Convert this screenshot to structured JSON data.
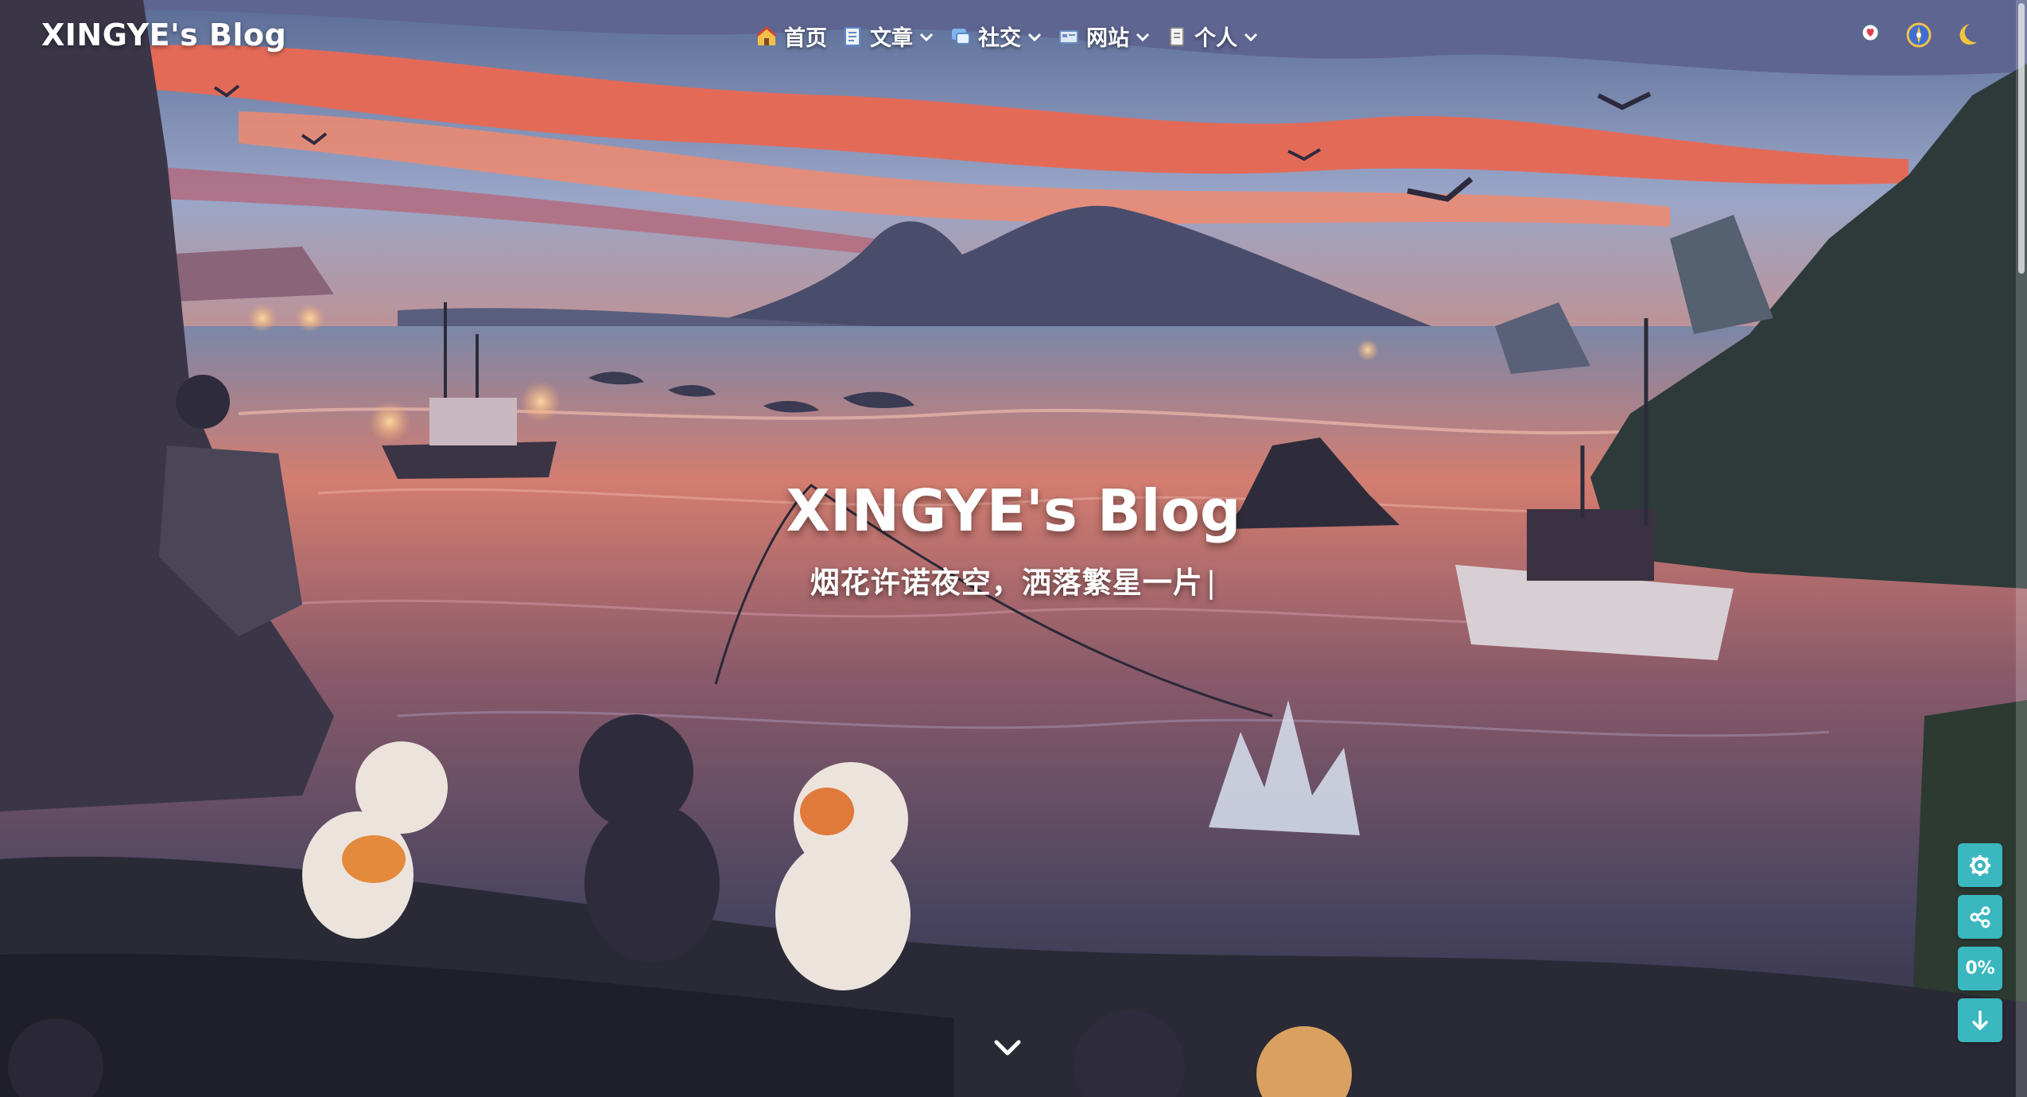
{
  "site": {
    "name": "XINGYE's Blog"
  },
  "nav": {
    "items": [
      {
        "label": "首页",
        "icon": "home-icon",
        "has_dropdown": false
      },
      {
        "label": "文章",
        "icon": "article-icon",
        "has_dropdown": true
      },
      {
        "label": "社交",
        "icon": "chat-icon",
        "has_dropdown": true
      },
      {
        "label": "网站",
        "icon": "website-icon",
        "has_dropdown": true
      },
      {
        "label": "个人",
        "icon": "profile-icon",
        "has_dropdown": true
      }
    ],
    "tools": [
      {
        "name": "search-heart-icon"
      },
      {
        "name": "compass-icon"
      },
      {
        "name": "moon-icon"
      }
    ]
  },
  "hero": {
    "title": "XINGYE's Blog",
    "subtitle": "烟花许诺夜空，洒落繁星一片",
    "cursor": "|"
  },
  "side_buttons": {
    "settings": "settings-icon",
    "share": "share-icon",
    "progress": "0%",
    "down": "arrow-down-icon"
  },
  "colors": {
    "accent": "#3ab7bf",
    "sky_top": "#4a5a80",
    "sunset": "#e6705a",
    "water": "#3d3a5a"
  }
}
